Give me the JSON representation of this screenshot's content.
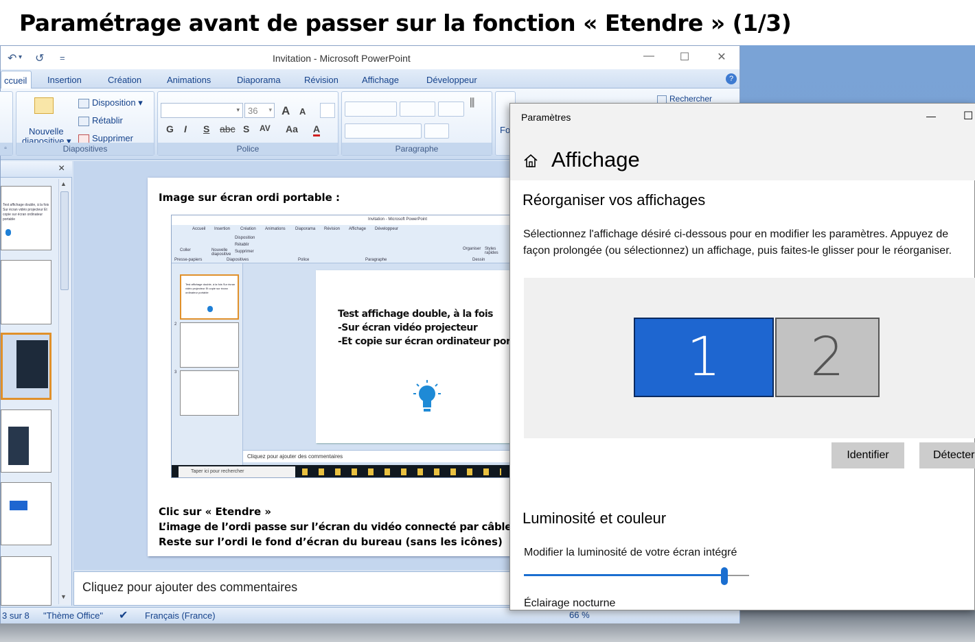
{
  "page_title": "Paramétrage avant de passer sur la fonction « Etendre » (1/3)",
  "powerpoint": {
    "title": "Invitation - Microsoft PowerPoint",
    "quick_access": [
      "↶",
      "↺",
      "="
    ],
    "window_controls": [
      "—",
      "☐",
      "✕"
    ],
    "help_icon": "?",
    "tabs": [
      "ccueil",
      "Insertion",
      "Création",
      "Animations",
      "Diaporama",
      "Révision",
      "Affichage",
      "Développeur"
    ],
    "ribbon": {
      "diapositives": {
        "new_slide_line1": "Nouvelle",
        "new_slide_line2": "diapositive ▾",
        "disposition": "Disposition ▾",
        "retablir": "Rétablir",
        "supprimer": "Supprimer",
        "label": "Diapositives"
      },
      "police": {
        "font_size": "36",
        "label": "Police",
        "buttons": [
          "G",
          "I",
          "S",
          "abc",
          "S",
          "AV",
          "Aa",
          "A"
        ],
        "grow": "A",
        "shrink": "A"
      },
      "paragraphe": {
        "label": "Paragraphe"
      },
      "dessin_partial": "Fo",
      "rechercher": "Rechercher"
    },
    "slide_panel_close": "×",
    "slide": {
      "heading": "Image sur écran ordi portable :",
      "footer_line1": "Clic sur « Etendre »",
      "footer_line2": "L’image de l’ordi passe sur l’écran du vidéo connecté par câble HDMI",
      "footer_line3": "Reste sur l’ordi le fond d’écran du bureau (sans les icônes)",
      "inner_screenshot": {
        "title": "Invitation - Microsoft PowerPoint",
        "tabs": [
          "Accueil",
          "Insertion",
          "Création",
          "Animations",
          "Diaporama",
          "Révision",
          "Affichage",
          "Développeur"
        ],
        "group_labels": [
          "Presse-papiers",
          "Diapositives",
          "Police",
          "Paragraphe",
          "Dessin"
        ],
        "small_buttons": [
          "Coller",
          "Nouvelle diapositive",
          "Disposition",
          "Rétablir",
          "Supprimer",
          "Organiser",
          "Styles rapides"
        ],
        "slide_line1": "Test affichage double, à la fois",
        "slide_line2": "-Sur écran vidéo projecteur",
        "slide_line3": "-Et copie sur écran ordinateur portable",
        "thumb_text": "Test affichage double, à la fois Sur écran vidéo projecteur Et copie sur écran ordinateur portable",
        "thumb_numbers": [
          "2",
          "3"
        ],
        "comments": "Cliquez pour ajouter des commentaires",
        "taskbar_search": "Taper ici pour rechercher"
      }
    },
    "comments_placeholder": "Cliquez pour ajouter des commentaires",
    "status": {
      "slide_count": "3 sur 8",
      "theme": "\"Thème Office\"",
      "language": "Français (France)",
      "zoom": "66 %"
    }
  },
  "settings": {
    "window_title": "Paramètres",
    "minimize": "—",
    "maximize": "☐",
    "page": "Affichage",
    "section1": "Réorganiser vos affichages",
    "description_line1": "Sélectionnez l'affichage désiré ci-dessous pour en modifier les paramètres. Appuyez de",
    "description_line2": "façon prolongée (ou sélectionnez) un affichage, puis faites-le glisser pour le réorganiser.",
    "monitors": [
      "1",
      "2"
    ],
    "identify_button": "Identifier",
    "detect_button": "Détecter",
    "section2": "Luminosité et couleur",
    "brightness_label": "Modifier la luminosité de votre écran intégré",
    "brightness_value": 0.89,
    "night_light": "Éclairage nocturne",
    "colors": {
      "accent": "#1a6ed0",
      "monitor_selected": "#1e66d0",
      "monitor_other": "#c2c2c2"
    }
  }
}
